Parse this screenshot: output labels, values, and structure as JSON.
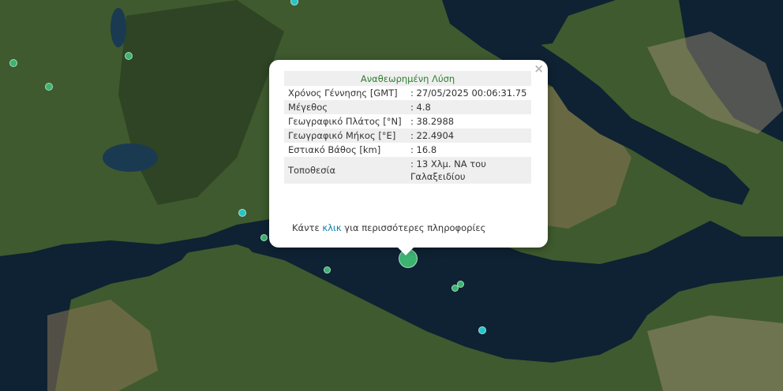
{
  "map": {
    "colors": {
      "sea": "#0e2233",
      "sea_light": "#1a3a52",
      "land_green": "#3f5a2e",
      "land_dark": "#2b3f22",
      "land_brown": "#8a7656",
      "land_tan": "#a79577"
    },
    "main_marker_color": "#3cb371",
    "green_marker_color": "#3cb371",
    "teal_marker_color": "#29c4c4"
  },
  "popup": {
    "title": "Αναθεωρημένη Λύση",
    "close_icon": "×",
    "rows": [
      {
        "label": "Χρόνος Γέννησης [GMT]",
        "value": ": 27/05/2025 00:06:31.75"
      },
      {
        "label": "Μέγεθος",
        "value": ": 4.8"
      },
      {
        "label": "Γεωγραφικό Πλάτος [°N]",
        "value": ": 38.2988"
      },
      {
        "label": "Γεωγραφικό Μήκος [°E]",
        "value": ": 22.4904"
      },
      {
        "label": "Εστιακό Βάθος [km]",
        "value": ": 16.8"
      },
      {
        "label": "Τοποθεσία",
        "value": ": 13 Χλμ. ΝΑ του Γαλαξειδίου"
      }
    ],
    "more_prefix": "Κάντε",
    "more_link": "κλικ",
    "more_suffix": "για περισσότερες πληροφορίες"
  }
}
